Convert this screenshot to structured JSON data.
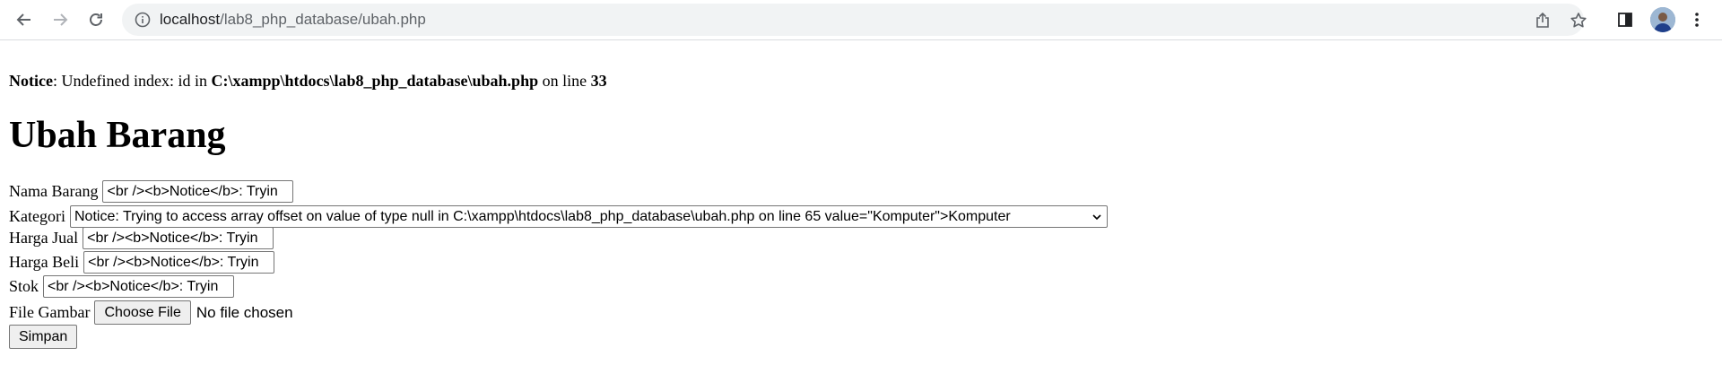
{
  "browser": {
    "url_host": "localhost",
    "url_path": "/lab8_php_database/ubah.php"
  },
  "notice": {
    "label": "Notice",
    "message": ": Undefined index: id in ",
    "file": "C:\\xampp\\htdocs\\lab8_php_database\\ubah.php",
    "line_text": " on line ",
    "line_number": "33"
  },
  "page": {
    "title": "Ubah Barang"
  },
  "form": {
    "nama_label": "Nama Barang",
    "nama_value": "<br /><b>Notice</b>:  Tryin",
    "kategori_label": "Kategori",
    "kategori_selected": "Notice: Trying to access array offset on value of type null in C:\\xampp\\htdocs\\lab8_php_database\\ubah.php on line 65 value=\"Komputer\">Komputer",
    "harga_jual_label": "Harga Jual",
    "harga_jual_value": "<br /><b>Notice</b>:  Tryin",
    "harga_beli_label": "Harga Beli",
    "harga_beli_value": "<br /><b>Notice</b>:  Tryin",
    "stok_label": "Stok",
    "stok_value": "<br /><b>Notice</b>:  Tryin",
    "file_label": "File Gambar",
    "choose_file_label": "Choose File",
    "no_file_text": "No file chosen",
    "submit_label": "Simpan"
  }
}
